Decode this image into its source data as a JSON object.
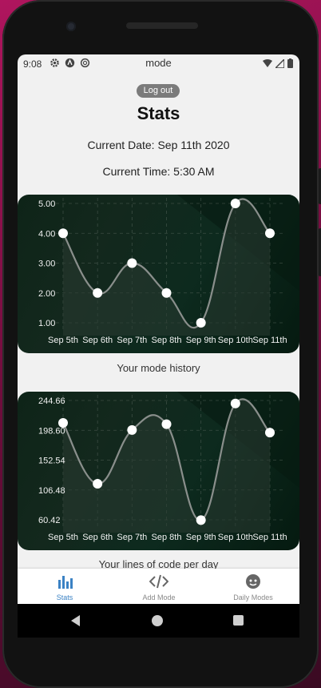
{
  "status_bar": {
    "time": "9:08",
    "app_name": "mode",
    "icons": [
      "gear-icon",
      "a-icon",
      "sync-icon"
    ],
    "right_icons": [
      "wifi-icon",
      "signal-icon",
      "battery-icon"
    ]
  },
  "header": {
    "logout_label": "Log out",
    "title": "Stats",
    "current_date": "Current Date: Sep 11th 2020",
    "current_time": "Current Time: 5:30 AM"
  },
  "colors": {
    "chart_bg": "#0e2418",
    "line": "#8a8f8c",
    "point": "#ffffff",
    "tick": "#f2f2f2",
    "active_nav": "#3b82c4"
  },
  "chart_data": [
    {
      "type": "line",
      "categories": [
        "Sep 5th",
        "Sep 6th",
        "Sep 7th",
        "Sep 8th",
        "Sep 9th",
        "Sep 10th",
        "Sep 11th"
      ],
      "values": [
        4,
        2,
        3,
        2,
        1,
        5,
        4
      ],
      "y_ticks": [
        "5.00",
        "4.00",
        "3.00",
        "2.00",
        "1.00"
      ],
      "ylim": [
        1,
        5
      ],
      "grid": true,
      "caption": "Your mode history"
    },
    {
      "type": "line",
      "categories": [
        "Sep 5th",
        "Sep 6th",
        "Sep 7th",
        "Sep 8th",
        "Sep 9th",
        "Sep 10th",
        "Sep 11th"
      ],
      "values": [
        210,
        116,
        199,
        208,
        60,
        240,
        195
      ],
      "y_ticks": [
        "244.66",
        "198.60",
        "152.54",
        "106.48",
        "60.42"
      ],
      "ylim": [
        60.42,
        244.66
      ],
      "grid": true,
      "caption": "Your lines of code per day"
    }
  ],
  "bottom_nav": [
    {
      "label": "Stats",
      "icon": "bar-chart-icon",
      "active": true
    },
    {
      "label": "Add Mode",
      "icon": "code-icon",
      "active": false
    },
    {
      "label": "Daily Modes",
      "icon": "face-icon",
      "active": false
    }
  ]
}
